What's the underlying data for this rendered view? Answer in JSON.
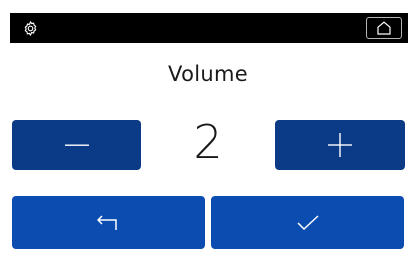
{
  "topbar": {
    "settings_icon": "gear-icon",
    "home_icon": "home-icon"
  },
  "title": "Volume",
  "volume": {
    "value": "2",
    "decrease_icon": "minus-icon",
    "increase_icon": "plus-icon"
  },
  "actions": {
    "back_icon": "back-arrow-icon",
    "confirm_icon": "checkmark-icon"
  },
  "colors": {
    "topbar_bg": "#000000",
    "stepper_button": "#0b3a87",
    "action_button": "#0b4cb0",
    "text": "#1a1a1a"
  }
}
